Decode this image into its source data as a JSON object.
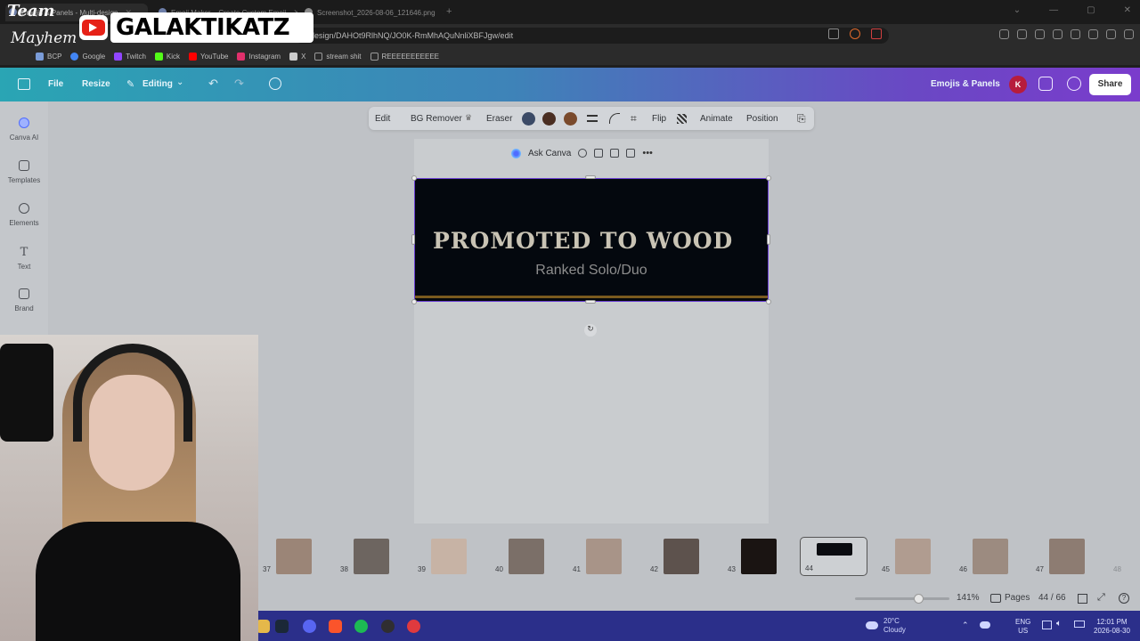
{
  "browser": {
    "tabs": [
      {
        "label": "Emojis & Panels - Multi-design"
      },
      {
        "label": "Emoji Maker – Create Custom Emoji"
      },
      {
        "label": "Screenshot_2026-08-06_121646.png"
      }
    ],
    "url": "design/DAHOt9RlhNQ/JO0K-RmMhAQuNnliXBFJgw/edit",
    "bookmarks": [
      {
        "label": "BCP",
        "color": "#7a9cd8"
      },
      {
        "label": "Google",
        "color": "#4285f4"
      },
      {
        "label": "Twitch",
        "color": "#9146ff"
      },
      {
        "label": "Kick",
        "color": "#53fc18"
      },
      {
        "label": "YouTube",
        "color": "#ff0000"
      },
      {
        "label": "Instagram",
        "color": "#e1306c"
      },
      {
        "label": "X",
        "color": "#cccccc"
      },
      {
        "label": "stream shit",
        "color": "#999999"
      },
      {
        "label": "REEEEEEEEEEE",
        "color": "#999999"
      }
    ]
  },
  "overlay": {
    "team_line1": "Team",
    "team_line2": "Mayhem",
    "channel_name": "GALAKTIKATZ"
  },
  "canva_header": {
    "file": "File",
    "resize": "Resize",
    "editing": "Editing",
    "project_name": "Emojis & Panels",
    "avatar_initial": "K",
    "share": "Share"
  },
  "sidebar": {
    "items": [
      {
        "label": "Canva AI",
        "icon": "canva-ai-icon"
      },
      {
        "label": "Templates",
        "icon": "templates-icon"
      },
      {
        "label": "Elements",
        "icon": "elements-icon"
      },
      {
        "label": "Text",
        "icon": "text-icon"
      },
      {
        "label": "Brand",
        "icon": "brand-icon"
      }
    ]
  },
  "toolbar": {
    "edit": "Edit",
    "bg_remover": "BG Remover",
    "eraser": "Eraser",
    "flip": "Flip",
    "animate": "Animate",
    "position": "Position",
    "swatches": [
      "#3b4a66",
      "#4a2e22",
      "#7a4a2c"
    ]
  },
  "ask_canva": {
    "label": "Ask Canva"
  },
  "banner": {
    "title": "PROMOTED TO WOOD",
    "subtitle": "Ranked Solo/Duo"
  },
  "pages": {
    "thumbnails": [
      {
        "num": "37"
      },
      {
        "num": "38"
      },
      {
        "num": "39"
      },
      {
        "num": "40"
      },
      {
        "num": "41"
      },
      {
        "num": "42"
      },
      {
        "num": "43"
      },
      {
        "num": "44",
        "selected": true
      },
      {
        "num": "45"
      },
      {
        "num": "46"
      },
      {
        "num": "47"
      },
      {
        "num": "48"
      }
    ],
    "zoom": "141%",
    "pages_label": "Pages",
    "page_count": "44 / 66"
  },
  "taskbar": {
    "weather_temp": "20°C",
    "weather_desc": "Cloudy",
    "lang": "ENG",
    "region": "US",
    "time": "12:01 PM",
    "date": "2026-08-30"
  }
}
